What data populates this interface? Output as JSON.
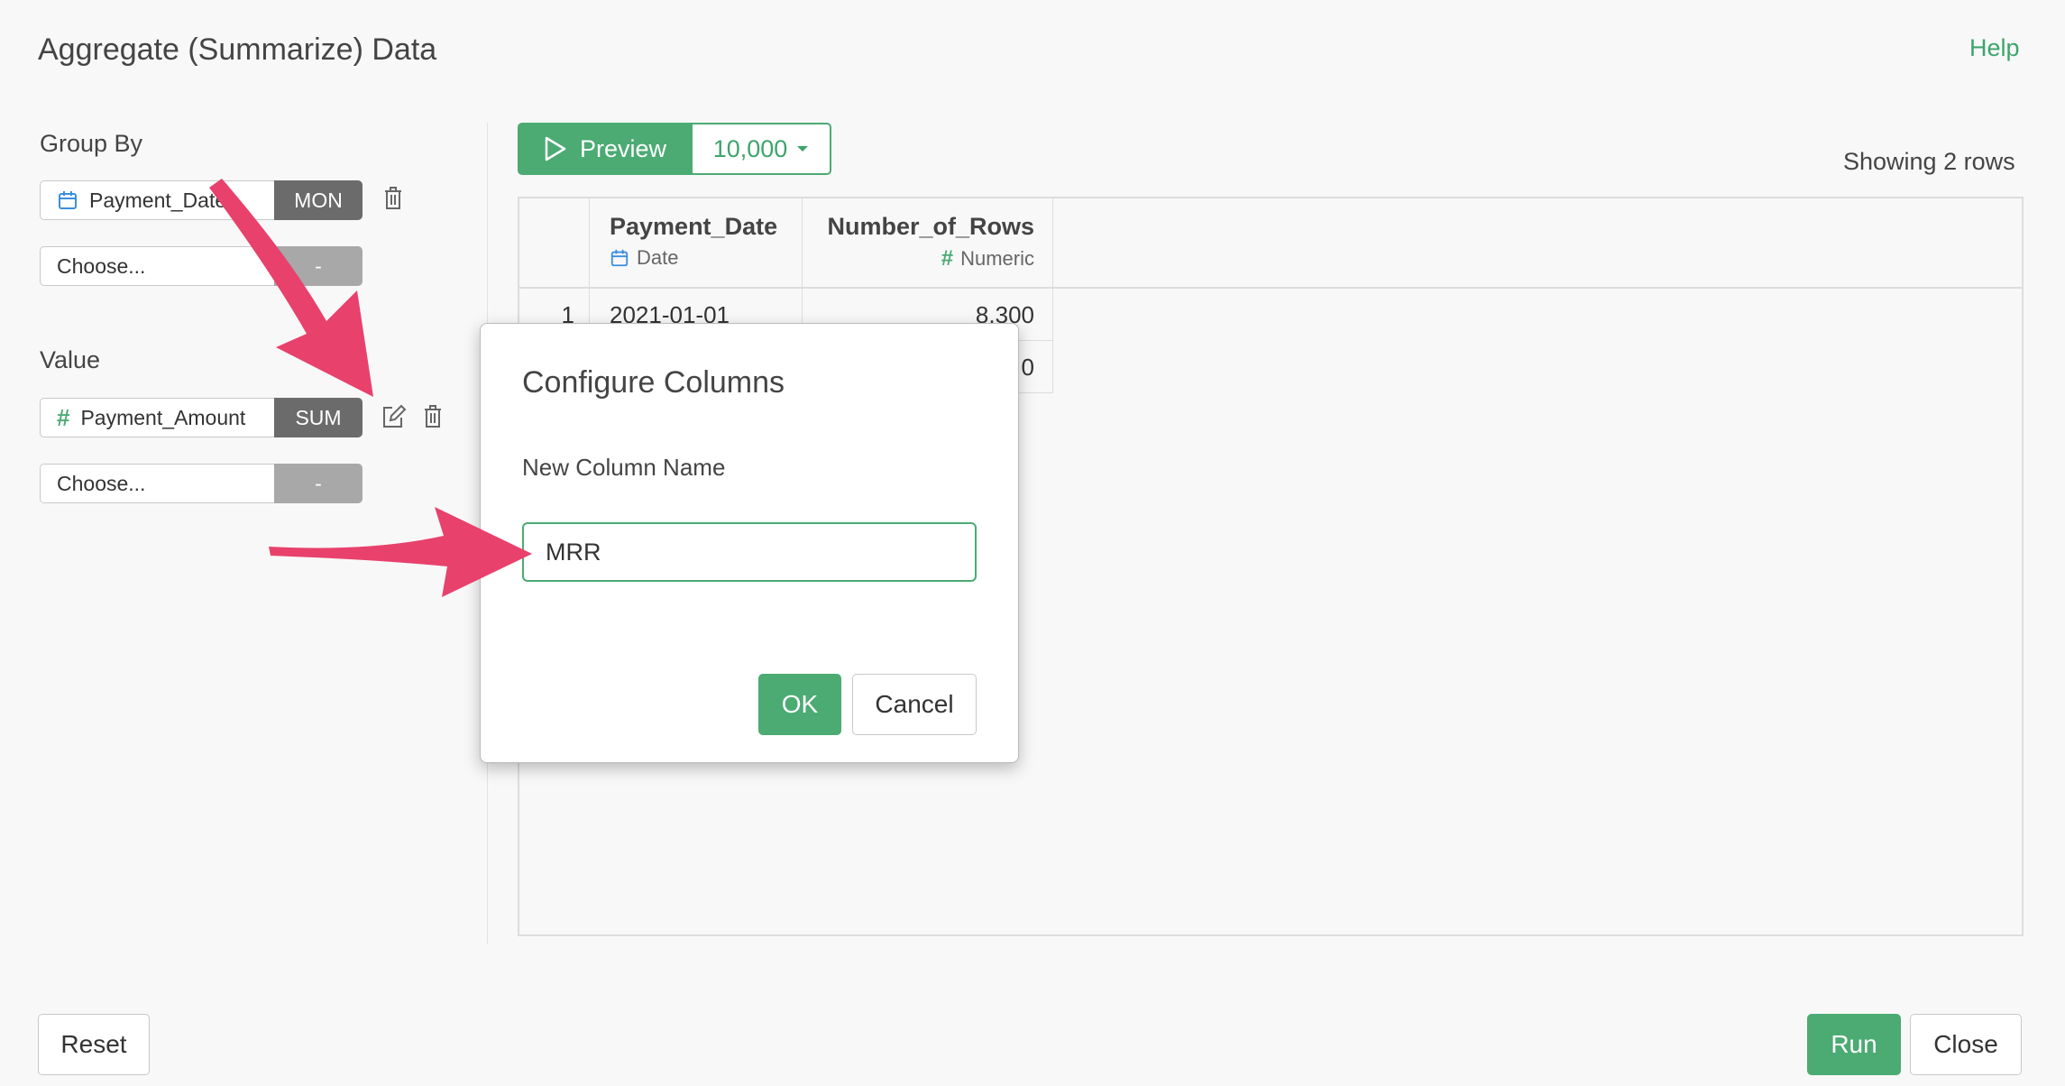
{
  "app": {
    "title": "Aggregate (Summarize) Data",
    "help_label": "Help"
  },
  "group_by": {
    "label": "Group By",
    "rows": [
      {
        "field": "Payment_Date",
        "aggregation": "MON",
        "type_icon": "calendar-icon"
      },
      {
        "field": "Choose...",
        "aggregation": "-"
      }
    ]
  },
  "value": {
    "label": "Value",
    "rows": [
      {
        "field": "Payment_Amount",
        "aggregation": "SUM",
        "type_icon": "hash-icon"
      },
      {
        "field": "Choose...",
        "aggregation": "-"
      }
    ]
  },
  "preview": {
    "button_label": "Preview",
    "row_limit": "10,000",
    "showing_text": "Showing 2 rows"
  },
  "table": {
    "columns": [
      {
        "name": "Payment_Date",
        "type": "Date",
        "type_icon": "calendar-icon"
      },
      {
        "name": "Number_of_Rows",
        "type": "Numeric",
        "type_icon": "hash-icon"
      }
    ],
    "rows": [
      {
        "index": "1",
        "values": [
          "2021-01-01",
          "8,300"
        ]
      },
      {
        "index": "",
        "values": [
          "",
          "0"
        ]
      }
    ]
  },
  "modal": {
    "title": "Configure Columns",
    "field_label": "New Column Name",
    "input_value": "MRR",
    "ok_label": "OK",
    "cancel_label": "Cancel"
  },
  "footer": {
    "reset_label": "Reset",
    "run_label": "Run",
    "close_label": "Close"
  },
  "colors": {
    "accent": "#4bab73",
    "annotation_arrow": "#e8416c",
    "calendar_icon": "#3b8ede"
  }
}
